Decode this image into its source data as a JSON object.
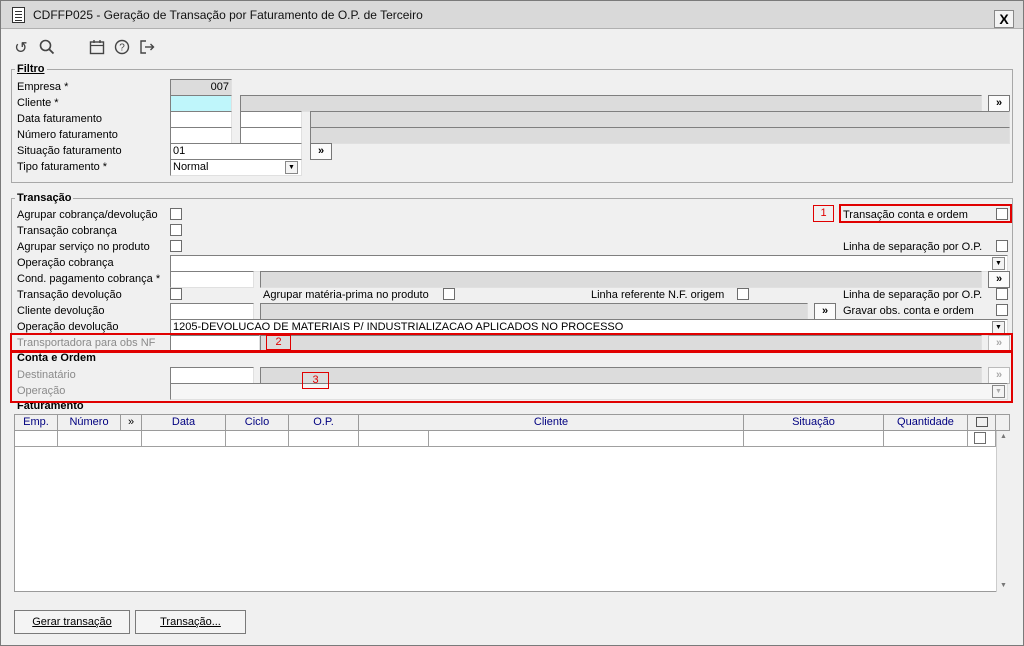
{
  "window": {
    "title": "CDFFP025 - Geração de Transação por Faturamento de O.P. de Terceiro",
    "close": "X"
  },
  "toolbar": {
    "reset": "↺",
    "search": "○",
    "calendar": "▦",
    "help": "?",
    "exit": "⇥"
  },
  "filtro": {
    "title": "Filtro",
    "empresa_label": "Empresa *",
    "empresa_value": "007",
    "cliente_label": "Cliente *",
    "data_label": "Data faturamento",
    "numero_label": "Número faturamento",
    "situacao_label": "Situação faturamento",
    "situacao_value": "01",
    "tipo_label": "Tipo faturamento *",
    "tipo_value": "Normal",
    "more": "»"
  },
  "transacao": {
    "title": "Transação",
    "agrupar_cobranca": "Agrupar cobrança/devolução",
    "transacao_cobranca": "Transação cobrança",
    "agrupar_servico": "Agrupar serviço no produto",
    "operacao_cobranca": "Operação cobrança",
    "cond_pagamento": "Cond. pagamento cobrança *",
    "transacao_devolucao": "Transação devolução",
    "cliente_devolucao": "Cliente devolução",
    "operacao_devolucao": "Operação devolução",
    "operacao_devolucao_value": "1205-DEVOLUCAO DE MATERIAIS P/ INDUSTRIALIZACAO APLICADOS NO PROCESSO",
    "transportadora": "Transportadora para obs NF",
    "conta_ordem": "Transação conta e ordem",
    "linha_sep_op": "Linha de separação por O.P.",
    "agrupar_mp": "Agrupar matéria-prima no produto",
    "linha_ref_nf": "Linha referente N.F. origem",
    "linha_sep_op2": "Linha de separação por O.P.",
    "gravar_obs": "Gravar obs. conta e ordem",
    "more": "»"
  },
  "conta_ordem": {
    "title": "Conta e Ordem",
    "destinatario": "Destinatário",
    "operacao": "Operação"
  },
  "annotations": {
    "n1": "1",
    "n2": "2",
    "n3": "3"
  },
  "faturamento": {
    "title": "Faturamento",
    "columns": [
      "Emp.",
      "Número",
      "»",
      "Data",
      "Ciclo",
      "O.P.",
      "Cliente",
      "Situação",
      "Quantidade"
    ]
  },
  "buttons": {
    "gerar": "Gerar transação",
    "transacao": "Transação..."
  }
}
